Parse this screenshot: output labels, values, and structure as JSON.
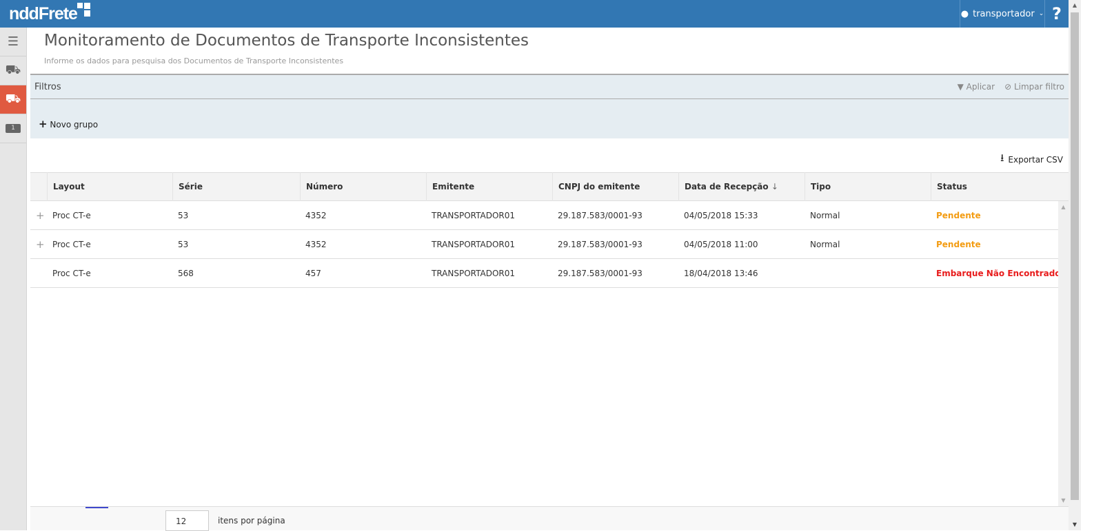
{
  "header": {
    "logo": "nddFrete",
    "user": "transportador",
    "help": "?"
  },
  "sidebar": {
    "items": [
      {
        "icon": "menu-icon"
      },
      {
        "icon": "truck-icon"
      },
      {
        "icon": "truck-document-icon",
        "active": true
      },
      {
        "icon": "money-icon"
      }
    ]
  },
  "page": {
    "title": "Monitoramento de Documentos de Transporte Inconsistentes",
    "subtitle": "Informe os dados para pesquisa dos Documentos de Transporte Inconsistentes"
  },
  "filters": {
    "title": "Filtros",
    "apply": "Aplicar",
    "clear": "Limpar filtro",
    "new_group": "Novo grupo"
  },
  "export_label": "Exportar CSV",
  "table": {
    "columns": [
      "Layout",
      "Série",
      "Número",
      "Emitente",
      "CNPJ do emitente",
      "Data de Recepção",
      "Tipo",
      "Status"
    ],
    "sort_indicator": "↓",
    "rows": [
      {
        "expand": "+",
        "layout": "Proc CT-e",
        "serie": "53",
        "numero": "4352",
        "emitente": "TRANSPORTADOR01",
        "cnpj": "29.187.583/0001-93",
        "data": "04/05/2018 15:33",
        "tipo": "Normal",
        "status": "Pendente",
        "status_color": "#f39c12"
      },
      {
        "expand": "+",
        "layout": "Proc CT-e",
        "serie": "53",
        "numero": "4352",
        "emitente": "TRANSPORTADOR01",
        "cnpj": "29.187.583/0001-93",
        "data": "04/05/2018 11:00",
        "tipo": "Normal",
        "status": "Pendente",
        "status_color": "#f39c12"
      },
      {
        "expand": "",
        "layout": "Proc CT-e",
        "serie": "568",
        "numero": "457",
        "emitente": "TRANSPORTADOR01",
        "cnpj": "29.187.583/0001-93",
        "data": "18/04/2018 13:46",
        "tipo": "",
        "status": "Embarque Não Encontrado",
        "status_color": "#e81c1c"
      }
    ]
  },
  "pager": {
    "page_size": "12",
    "label": "itens por página"
  }
}
